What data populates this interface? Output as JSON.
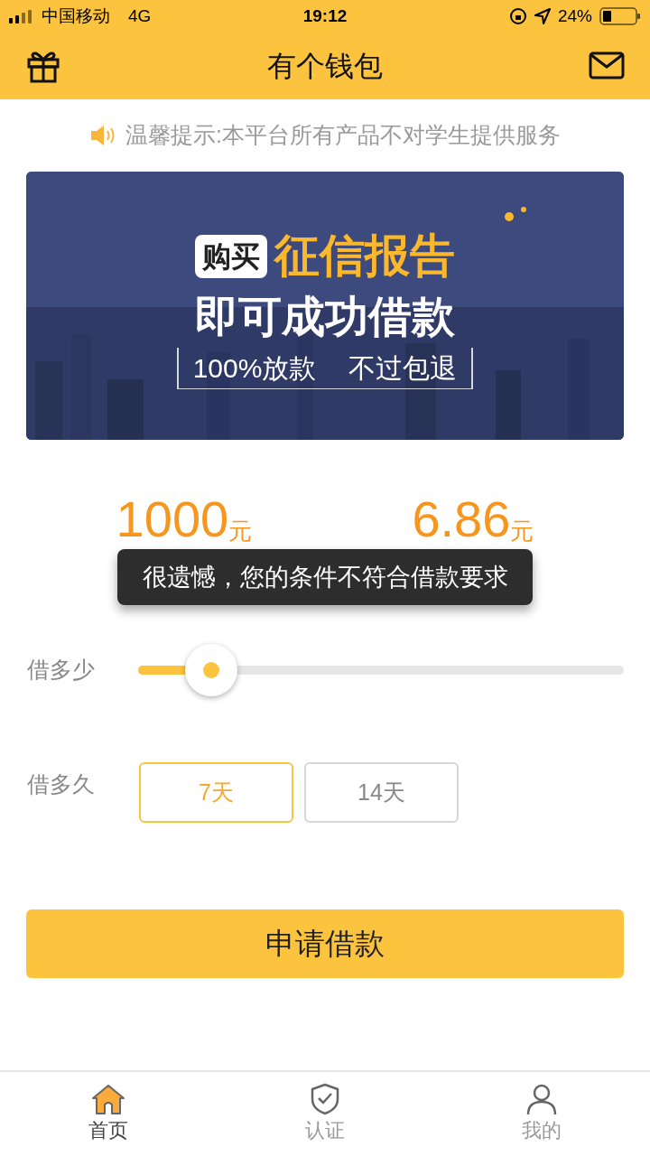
{
  "status_bar": {
    "carrier": "中国移动",
    "network": "4G",
    "time": "19:12",
    "battery": "24%"
  },
  "header": {
    "title": "有个钱包"
  },
  "notice": "温馨提示:本平台所有产品不对学生提供服务",
  "banner": {
    "tag": "购买",
    "headline": "征信报告",
    "subline": "即可成功借款",
    "slogans": [
      "100%放款",
      "不过包退"
    ]
  },
  "amounts": [
    {
      "value": "1000",
      "unit": "元"
    },
    {
      "value": "6.86",
      "unit": "元"
    }
  ],
  "toast": "很遗憾，您的条件不符合借款要求",
  "amount_slider": {
    "label": "借多少",
    "level": 0.15
  },
  "duration": {
    "label": "借多久",
    "options": [
      {
        "label": "7天",
        "selected": true
      },
      {
        "label": "14天",
        "selected": false
      }
    ]
  },
  "apply_button": "申请借款",
  "tab_bar": [
    {
      "label": "首页",
      "kind": "home",
      "selected": true
    },
    {
      "label": "认证",
      "kind": "shield",
      "selected": false
    },
    {
      "label": "我的",
      "kind": "user",
      "selected": false
    }
  ]
}
